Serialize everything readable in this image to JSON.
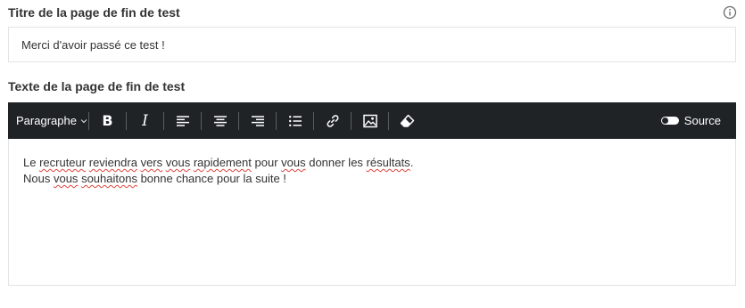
{
  "fields": {
    "title_label": "Titre de la page de fin de test",
    "title_value": "Merci d'avoir passé ce test !",
    "text_label": "Texte de la page de fin de test"
  },
  "toolbar": {
    "paragraph_label": "Paragraphe",
    "source_label": "Source",
    "source_enabled": false,
    "buttons": [
      "bold-icon",
      "italic-icon",
      "align-left-icon",
      "align-center-icon",
      "align-right-icon",
      "bulleted-list-icon",
      "link-icon",
      "image-icon",
      "eraser-icon"
    ]
  },
  "editor": {
    "line1": {
      "w1": "Le ",
      "w2": "recruteur",
      "w3": " ",
      "w4": "reviendra",
      "w5": " ",
      "w6": "vers",
      "w7": " ",
      "w8": "vous",
      "w9": " ",
      "w10": "rapidement",
      "w11": " pour ",
      "w12": "vous",
      "w13": " donner les ",
      "w14": "résultats",
      "w15": "."
    },
    "line2": {
      "w1": "Nous ",
      "w2": "vous",
      "w3": " ",
      "w4": "souhaitons",
      "w5": " bonne chance pour la suite !"
    }
  },
  "colors": {
    "toolbar_bg": "#1f2326",
    "spellcheck": "#e0443c",
    "border": "#e3e3e3"
  }
}
